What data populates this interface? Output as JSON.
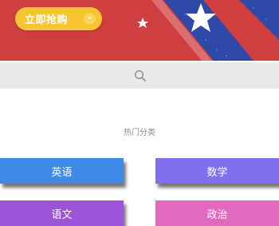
{
  "banner": {
    "buy_button_label": "立即抢购",
    "buy_arrow": "»",
    "colors": {
      "background": "#cf3f3f",
      "stripe": "#2f49a8",
      "button": "#f7c432"
    }
  },
  "search": {
    "icon": "search-icon"
  },
  "categories": {
    "title": "热门分类",
    "items": [
      {
        "label": "英语",
        "color": "#3f8ae7"
      },
      {
        "label": "数学",
        "color": "#7f70f0"
      },
      {
        "label": "语文",
        "color": "#9e54d8"
      },
      {
        "label": "政治",
        "color": "#e169be"
      }
    ]
  }
}
